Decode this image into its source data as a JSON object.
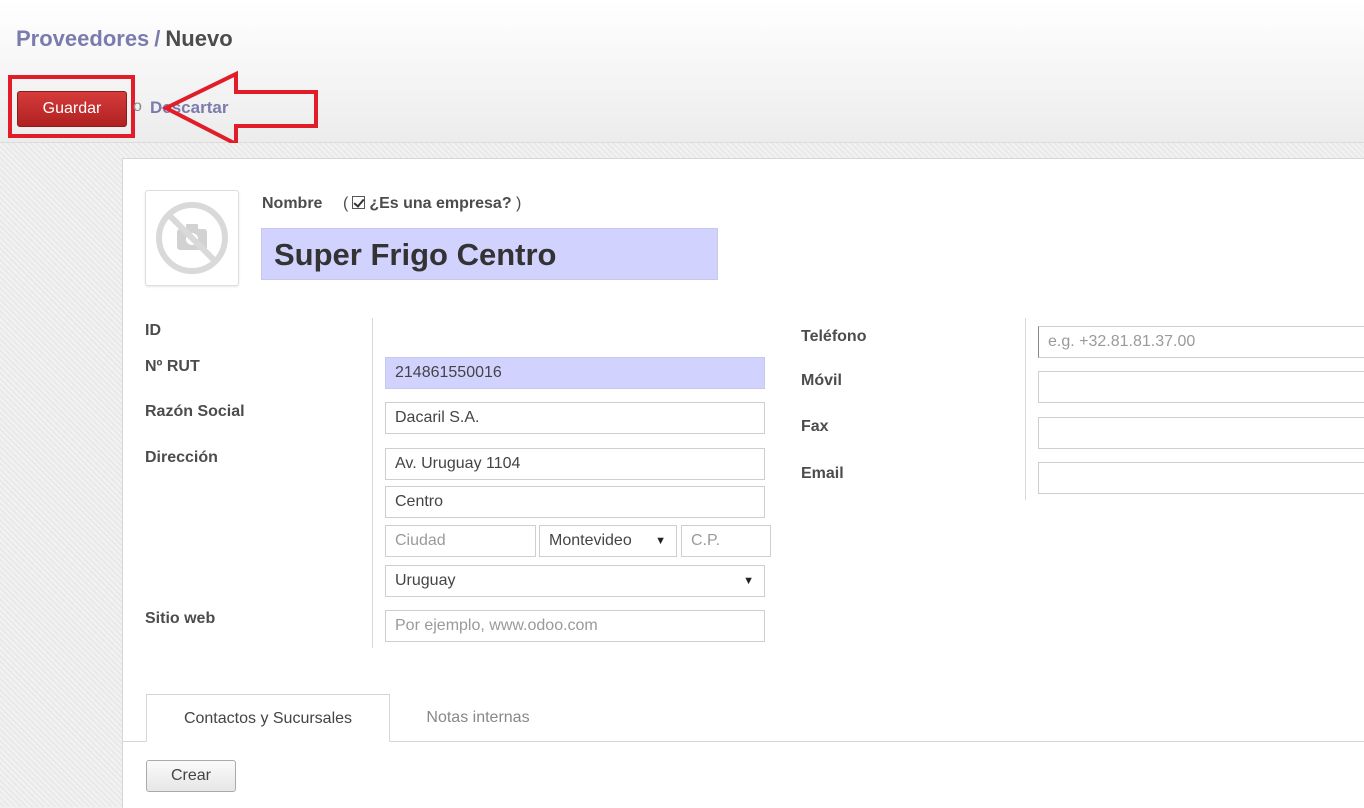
{
  "breadcrumb": {
    "parent": "Proveedores",
    "separator": "/",
    "current": "Nuevo"
  },
  "toolbar": {
    "save_label": "Guardar",
    "or_label": "o",
    "discard_label": "Descartar"
  },
  "annotation": {
    "highlight_color": "#e11d2a"
  },
  "header": {
    "name_label": "Nombre",
    "is_company_label": "¿Es una empresa?",
    "is_company_checked": true,
    "name_value": "Super Frigo Centro"
  },
  "form_left": {
    "id_label": "ID",
    "rut_label": "Nº RUT",
    "rut_value": "214861550016",
    "razon_label": "Razón Social",
    "razon_value": "Dacaril S.A.",
    "direccion_label": "Dirección",
    "street": "Av. Uruguay 1104",
    "street2": "Centro",
    "city_placeholder": "Ciudad",
    "state_value": "Montevideo",
    "zip_placeholder": "C.P.",
    "country_value": "Uruguay",
    "website_label": "Sitio web",
    "website_placeholder": "Por ejemplo, www.odoo.com"
  },
  "form_right": {
    "phone_label": "Teléfono",
    "phone_placeholder": "e.g. +32.81.81.37.00",
    "mobile_label": "Móvil",
    "fax_label": "Fax",
    "email_label": "Email"
  },
  "tabs": [
    {
      "label": "Contactos y Sucursales",
      "active": true
    },
    {
      "label": "Notas internas",
      "active": false
    }
  ],
  "actions": {
    "create_label": "Crear"
  },
  "icons": {
    "avatar": "no-photo-camera-icon",
    "select_arrow": "caret-down-icon",
    "annotation_arrow": "left-arrow-icon"
  }
}
